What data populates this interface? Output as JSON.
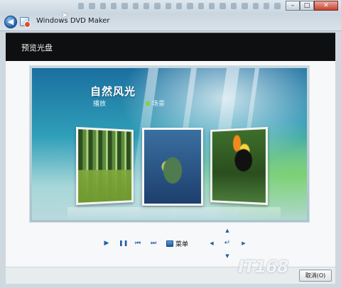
{
  "window": {
    "title": "Windows DVD Maker",
    "controls": {
      "minimize": "–",
      "maximize": "□",
      "close": "✕"
    }
  },
  "header": {
    "page_title": "预览光盘"
  },
  "disc_menu": {
    "title": "自然风光",
    "play_label": "播放",
    "scenes_label": "场景"
  },
  "player_controls": {
    "play": "▶",
    "pause": "❚❚",
    "previous": "⏮",
    "next": "⏭",
    "menu_label": "菜单",
    "up": "▲",
    "down": "▼",
    "left": "◀",
    "right": "▶",
    "enter": "↵"
  },
  "footer": {
    "cancel_label": "取消(O)"
  },
  "watermark": "IT168",
  "icons": [
    "back-arrow-icon",
    "dvd-maker-app-icon",
    "menu-icon"
  ],
  "colors": {
    "header_band": "#0e0f10",
    "accent": "#1d5fa9"
  }
}
